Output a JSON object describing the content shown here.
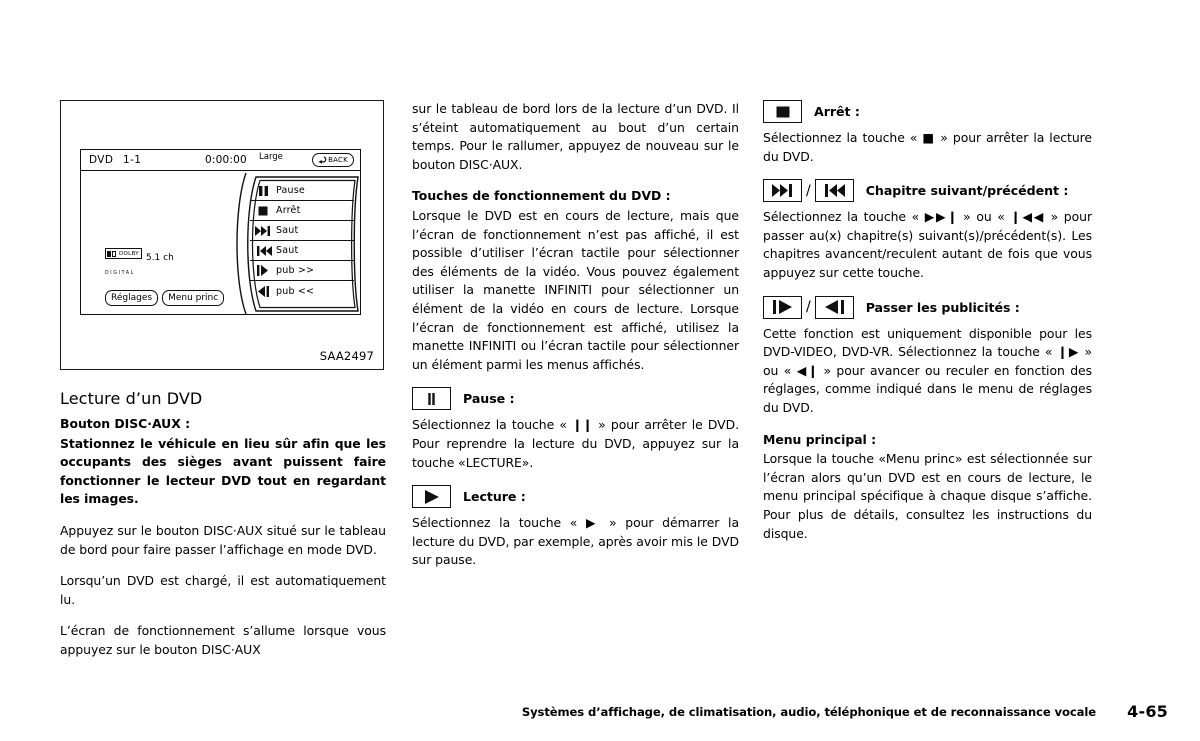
{
  "figure": {
    "code": "SAA2497",
    "screen": {
      "source_label": "DVD",
      "track_label": "1-1",
      "time": "0:00:00",
      "aspect_label": "Large",
      "back_button": "BACK",
      "audio_format_top": "DOLBY",
      "audio_format_bottom": "DIGITAL",
      "channels": "5.1 ch",
      "buttons": [
        {
          "label": "Réglages"
        },
        {
          "label": "Menu princ"
        }
      ],
      "menu_items": [
        {
          "icon": "pause-icon",
          "label": "Pause"
        },
        {
          "icon": "stop-icon",
          "label": "Arrêt"
        },
        {
          "icon": "skip-forward-icon",
          "label": "Saut"
        },
        {
          "icon": "skip-backward-icon",
          "label": "Saut"
        },
        {
          "icon": "ad-skip-forward-icon",
          "label": "pub >>"
        },
        {
          "icon": "ad-skip-backward-icon",
          "label": "pub <<"
        }
      ]
    }
  },
  "column1": {
    "section_title": "Lecture d’un DVD",
    "subhead": "Bouton DISC·AUX :",
    "warning": "Stationnez le véhicule en lieu sûr afin que les occupants des sièges avant puissent faire fonctionner le lecteur DVD tout en regardant les images.",
    "paragraphs": [
      "Appuyez sur le bouton DISC·AUX situé sur le tableau de bord pour faire passer l’affichage en mode DVD.",
      "Lorsqu’un DVD est chargé, il est automatiquement lu.",
      "L’écran de fonctionnement s’allume lorsque vous appuyez sur le bouton DISC·AUX"
    ]
  },
  "column2": {
    "continuation": "sur le tableau de bord lors de la lecture d’un DVD. Il s’éteint automatiquement au bout d’un certain temps. Pour le rallumer, appuyez de nouveau sur le bouton DISC·AUX.",
    "subhead": "Touches de fonctionnement du DVD :",
    "intro": "Lorsque le DVD est en cours de lecture, mais que l’écran de fonctionnement n’est pas affiché, il est possible d’utiliser l’écran tactile pour sélectionner des éléments de la vidéo. Vous pouvez également utiliser la manette INFINITI pour sélectionner un élément de la vidéo en cours de lecture. Lorsque l’écran de fonctionnement est affiché, utilisez la manette INFINITI ou l’écran tactile pour sélectionner un élément parmi les menus affichés.",
    "pause": {
      "heading": "Pause :",
      "body": "Sélectionnez la touche «  ❙❙  » pour arrêter le DVD. Pour reprendre la lecture du DVD, appuyez sur la touche «LECTURE»."
    },
    "play": {
      "heading": "Lecture :",
      "body": "Sélectionnez la touche « ▶ » pour démarrer la lecture du DVD, par exemple, après avoir mis le DVD sur pause."
    }
  },
  "column3": {
    "stop": {
      "heading": "Arrêt :",
      "body": "Sélectionnez la touche « ■ » pour arrêter la lecture du DVD."
    },
    "chapter": {
      "heading": "Chapitre suivant/précédent :",
      "body": "Sélectionnez la touche « ▶▶❙ » ou « ❙◀◀ » pour passer au(x) chapitre(s) suivant(s)/précédent(s). Les chapitres avancent/reculent autant de fois que vous appuyez sur cette touche."
    },
    "adskip": {
      "heading": "Passer les publicités :",
      "body": "Cette fonction est uniquement disponible pour les DVD-VIDEO, DVD-VR. Sélectionnez la touche « ❙▶ » ou « ◀❙ » pour avancer ou reculer en fonction des réglages, comme indiqué dans le menu de réglages du DVD."
    },
    "mainmenu": {
      "heading": "Menu principal :",
      "body": "Lorsque la touche «Menu princ» est sélectionnée sur l’écran alors qu’un DVD est en cours de lecture, le menu principal spécifique à chaque disque s’affiche. Pour plus de détails, consultez les instructions du disque."
    }
  },
  "footer": {
    "title": "Systèmes d’affichage, de climatisation, audio, téléphonique et de reconnaissance vocale",
    "page": "4-65"
  }
}
